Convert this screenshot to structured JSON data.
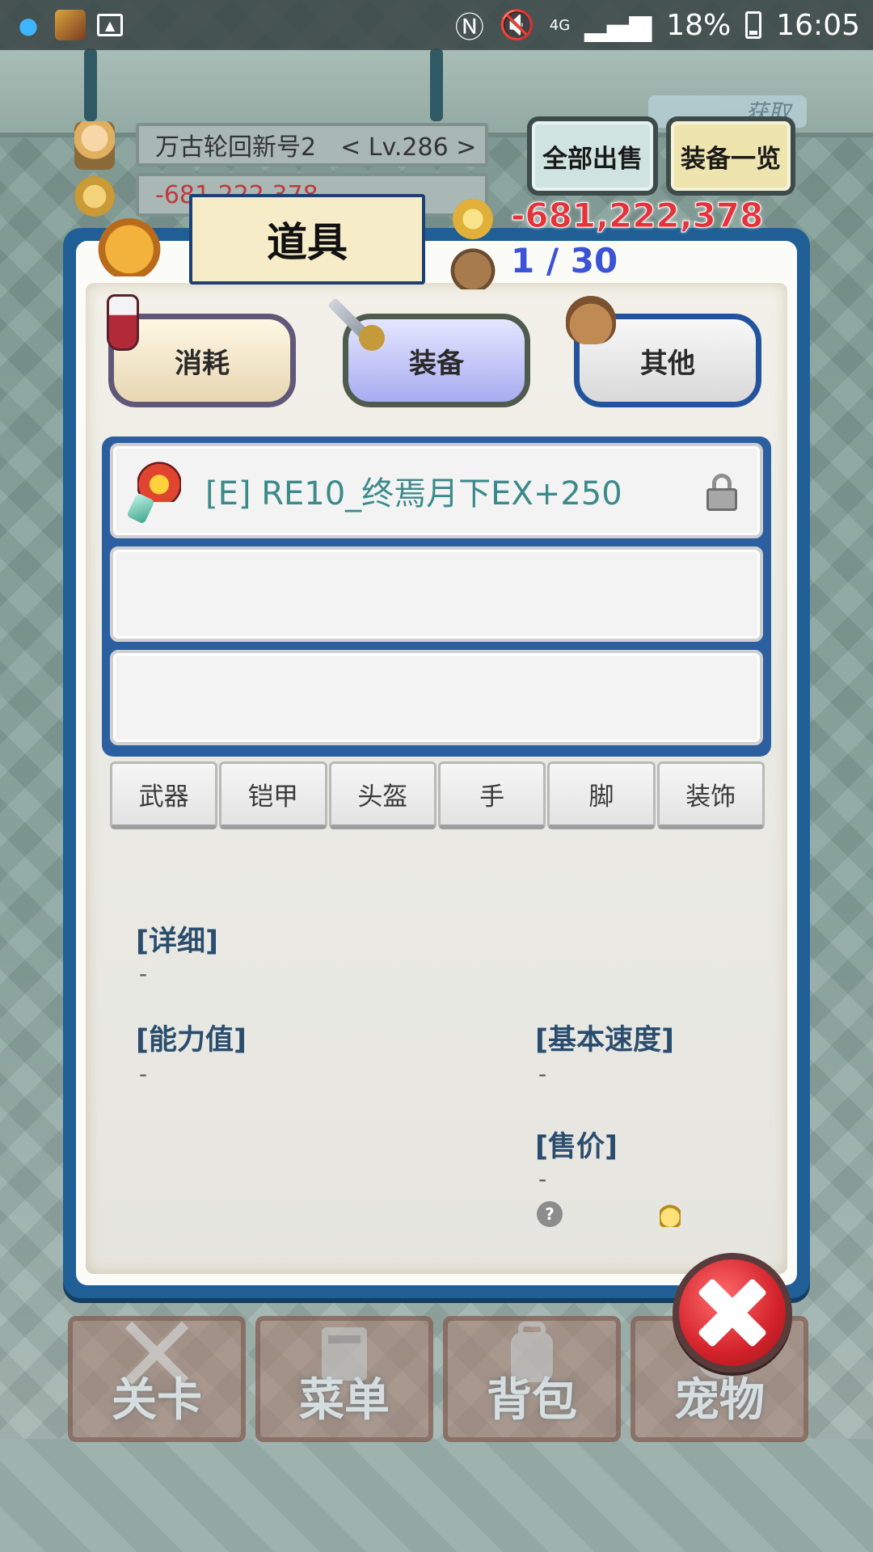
{
  "status_bar": {
    "network": "4G",
    "battery": "18%",
    "time": "16:05"
  },
  "hud": {
    "player_name_level": "万古轮回新号2　< Lv.286 >",
    "gold_hidden": "-681,222,378",
    "get_tag": "获取",
    "sell_all_label": "全部出售",
    "equip_list_label": "装备一览"
  },
  "panel": {
    "title": "道具",
    "gold": "-681,222,378",
    "capacity": "1 / 30",
    "categories": [
      {
        "label": "消耗"
      },
      {
        "label": "装备"
      },
      {
        "label": "其他"
      }
    ],
    "items": [
      {
        "label": "[E] RE10_终焉月下EX+250",
        "locked": true
      },
      {
        "label": ""
      },
      {
        "label": ""
      }
    ],
    "equip_types": [
      "武器",
      "铠甲",
      "头盔",
      "手",
      "脚",
      "装饰"
    ],
    "details": {
      "detail_label": "[详细]",
      "detail_value": "-",
      "ability_label": "[能力值]",
      "ability_value": "-",
      "speed_label": "[基本速度]",
      "speed_value": "-",
      "price_label": "[售价]",
      "price_value": "-"
    }
  },
  "bottom_nav": [
    {
      "label": "关卡",
      "icon": "crossed-swords-icon"
    },
    {
      "label": "菜单",
      "icon": "book-icon"
    },
    {
      "label": "背包",
      "icon": "backpack-icon"
    },
    {
      "label": "宠物",
      "icon": "pet-icon"
    }
  ],
  "colors": {
    "panel_border": "#1f5f96",
    "gold_text": "#e5333c",
    "capacity_text": "#3c53d6",
    "item_text": "#3b8a8a",
    "close_button": "#d3222b"
  }
}
